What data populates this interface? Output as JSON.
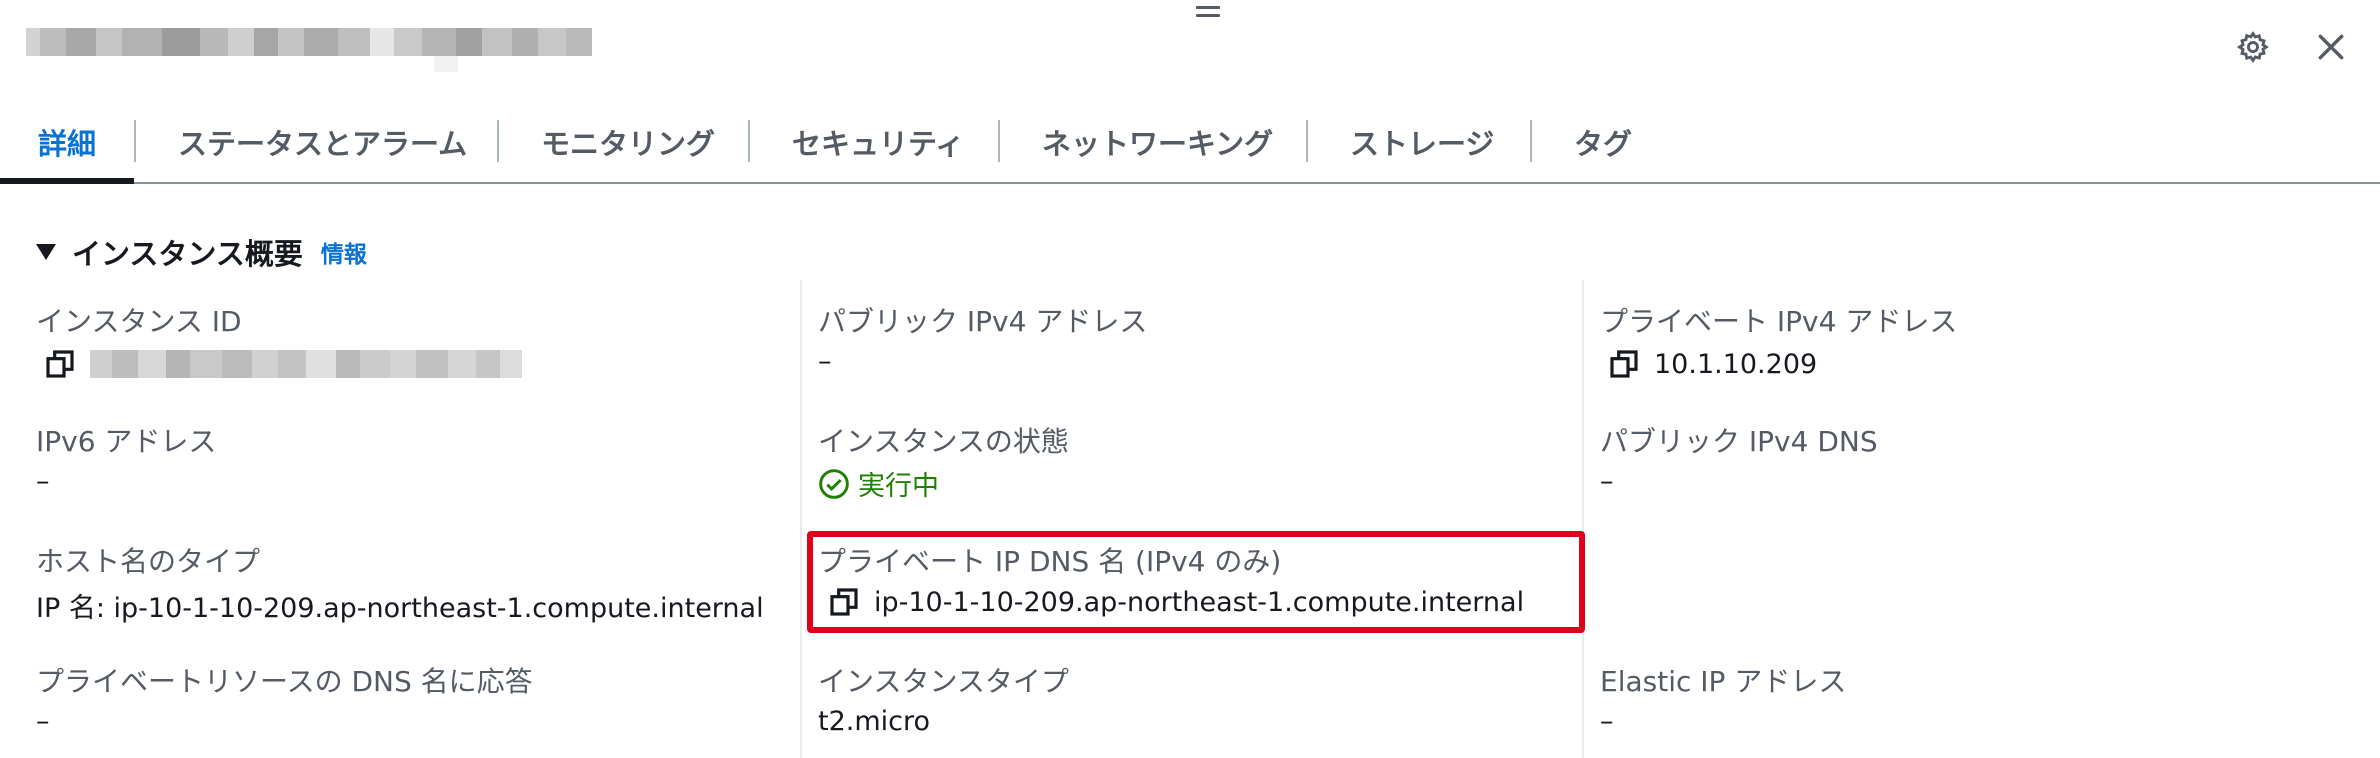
{
  "tabs": [
    {
      "label": "詳細"
    },
    {
      "label": "ステータスとアラーム"
    },
    {
      "label": "モニタリング"
    },
    {
      "label": "セキュリティ"
    },
    {
      "label": "ネットワーキング"
    },
    {
      "label": "ストレージ"
    },
    {
      "label": "タグ"
    }
  ],
  "section": {
    "title": "インスタンス概要",
    "info_label": "情報"
  },
  "fields": {
    "instance_id": {
      "label": "インスタンス ID"
    },
    "public_ipv4": {
      "label": "パブリック IPv4 アドレス",
      "value": "–"
    },
    "private_ipv4": {
      "label": "プライベート IPv4 アドレス",
      "value": "10.1.10.209"
    },
    "ipv6": {
      "label": "IPv6 アドレス",
      "value": "–"
    },
    "instance_state": {
      "label": "インスタンスの状態",
      "value": "実行中"
    },
    "public_ipv4_dns": {
      "label": "パブリック IPv4 DNS",
      "value": "–"
    },
    "hostname_type": {
      "label": "ホスト名のタイプ",
      "value": "IP 名: ip-10-1-10-209.ap-northeast-1.compute.internal"
    },
    "private_ip_dns": {
      "label": "プライベート IP DNS 名 (IPv4 のみ)",
      "value": "ip-10-1-10-209.ap-northeast-1.compute.internal"
    },
    "private_resource_dns": {
      "label": "プライベートリソースの DNS 名に応答",
      "value": "–"
    },
    "instance_type": {
      "label": "インスタンスタイプ",
      "value": "t2.micro"
    },
    "elastic_ip": {
      "label": "Elastic IP アドレス",
      "value": "–"
    }
  },
  "colors": {
    "accent": "#0972d3",
    "running": "#1d8102",
    "highlight": "#e1001a"
  },
  "icons": {
    "drag": "drag-handle-icon",
    "settings": "gear-icon",
    "close": "close-icon",
    "copy": "copy-icon",
    "status": "check-circle-icon",
    "caret": "caret-down-icon"
  }
}
